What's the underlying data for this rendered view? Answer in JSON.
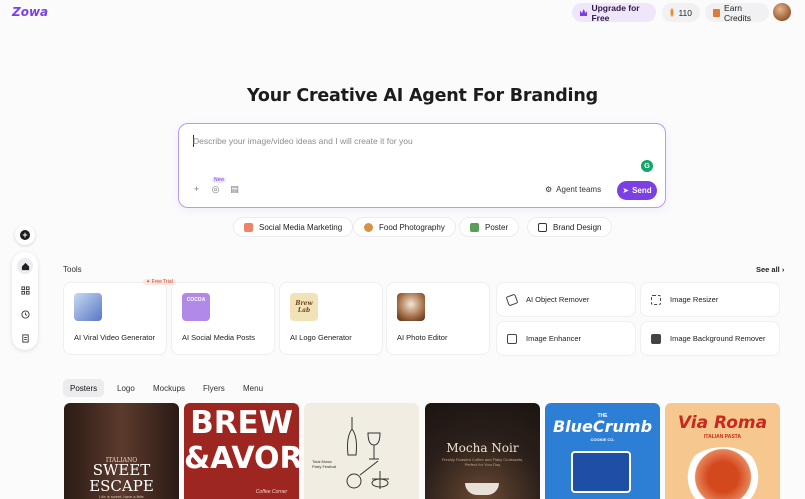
{
  "app": {
    "logo": "Zowa"
  },
  "header": {
    "upgrade_label": "Upgrade for Free",
    "credits": "110",
    "earn_label": "Earn Credits"
  },
  "hero": {
    "title": "Your Creative AI Agent For Branding",
    "placeholder": "Describe your image/video ideas and I will create it for you",
    "new_badge": "New",
    "agent_teams": "Agent teams",
    "send": "Send"
  },
  "chips": [
    {
      "label": "Social Media Marketing",
      "icon": "social-icon"
    },
    {
      "label": "Food Photography",
      "icon": "food-icon"
    },
    {
      "label": "Poster",
      "icon": "poster-icon"
    },
    {
      "label": "Brand Design",
      "icon": "brand-icon"
    }
  ],
  "tools": {
    "title": "Tools",
    "see_all": "See all",
    "free_trial": "Free Trial",
    "cards": [
      {
        "name": "AI Viral Video Generator"
      },
      {
        "name": "AI Social Media Posts",
        "thumb_text": "COCOA"
      },
      {
        "name": "AI Logo Generator",
        "thumb_text": "Brew Lab"
      },
      {
        "name": "AI Photo Editor"
      }
    ],
    "mini": [
      {
        "name": "AI Object Remover",
        "icon": "eraser-icon"
      },
      {
        "name": "Image Resizer",
        "icon": "crop-icon"
      },
      {
        "name": "Image Enhancer",
        "icon": "enhance-icon"
      },
      {
        "name": "Image Background Remover",
        "icon": "background-remove-icon"
      }
    ]
  },
  "tabs": [
    "Posters",
    "Logo",
    "Mockups",
    "Flyers",
    "Menu"
  ],
  "gallery": [
    {
      "l1": "ITALIANO",
      "l2": "SWEET",
      "l3": "ESCAPE",
      "l4": "Life is sweet, have a little"
    },
    {
      "l1": "BREW",
      "l2": "&AVOR",
      "l3": "Coffee Corner"
    },
    {
      "l1": "Total Music Party Festival"
    },
    {
      "l1": "Mocha Noir",
      "l2": "Freshly Roasted Coffee and Flaky Croissants, Perfect for Your Day"
    },
    {
      "l1": "THE",
      "l2": "BlueCrumb",
      "l3": "COOKIE CO."
    },
    {
      "l1": "Via Roma",
      "l2": "ITALIAN PASTA"
    }
  ],
  "colors": {
    "accent": "#7b3fe4",
    "send": "#7b3fe4",
    "border": "#b59cf0"
  }
}
